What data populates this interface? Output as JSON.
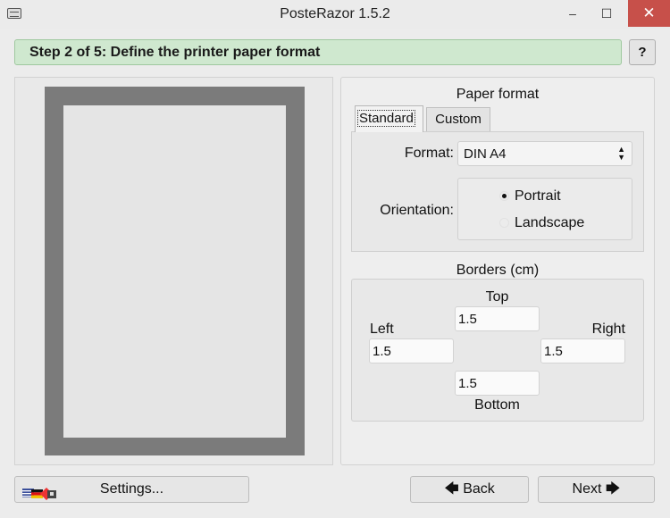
{
  "window": {
    "title": "PosteRazor 1.5.2",
    "minimize": "–",
    "maximize": "☐",
    "close": "✕"
  },
  "step": {
    "label": "Step 2 of 5: Define the printer paper format",
    "help": "?"
  },
  "paper_format": {
    "heading": "Paper format",
    "tabs": [
      "Standard",
      "Custom"
    ],
    "format_label": "Format:",
    "format_value": "DIN A4",
    "orientation_label": "Orientation:",
    "orientation_options": [
      "Portrait",
      "Landscape"
    ],
    "orientation_selected": "Portrait"
  },
  "borders": {
    "heading": "Borders (cm)",
    "top_label": "Top",
    "top_value": "1.5",
    "left_label": "Left",
    "left_value": "1.5",
    "right_label": "Right",
    "right_value": "1.5",
    "bottom_label": "Bottom",
    "bottom_value": "1.5"
  },
  "footer": {
    "settings_label": "Settings...",
    "back_label": "Back",
    "next_label": "Next"
  },
  "colors": {
    "step_banner": "#cfe8cf",
    "close_button": "#c7504a",
    "paper_border": "#7b7b7b"
  }
}
